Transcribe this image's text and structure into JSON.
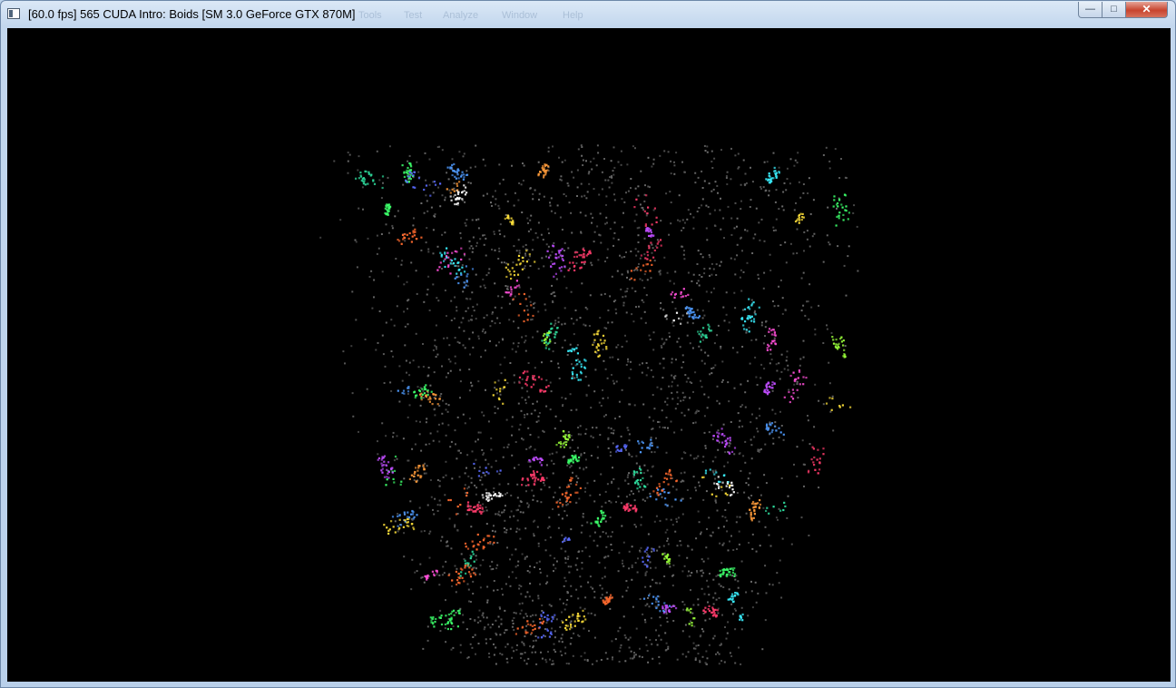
{
  "window": {
    "title": "[60.0 fps] 565 CUDA Intro: Boids [SM 3.0 GeForce GTX 870M]",
    "menu_ghost": [
      "Tools",
      "Test",
      "Analyze",
      "Window",
      "Help"
    ],
    "controls": {
      "minimize": "—",
      "maximize": "□",
      "close": "✕"
    }
  },
  "icons": {
    "app": "app-window-icon"
  },
  "viewport": {
    "background": "#000000",
    "particle_background_color": "#5c5c5c",
    "flock_colors": [
      "#ff3b6b",
      "#3cff6a",
      "#5a6bff",
      "#ffe13a",
      "#ff6a2e",
      "#3af0ff",
      "#c04dff",
      "#ff4fd8",
      "#9aff3a",
      "#ffffff",
      "#4f9bff",
      "#ff9b3a",
      "#2fe0a0"
    ]
  }
}
